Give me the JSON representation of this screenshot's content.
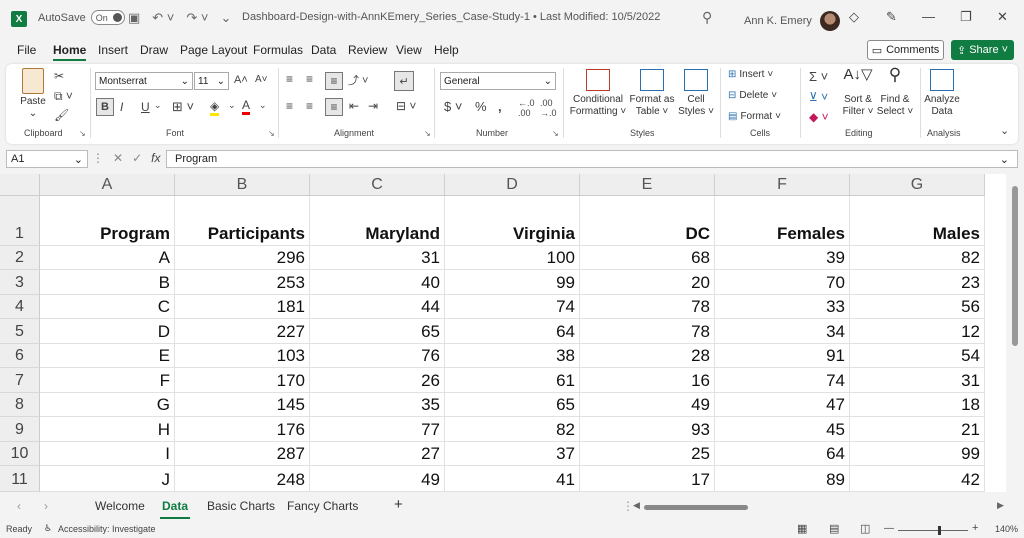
{
  "titlebar": {
    "app_icon": "X",
    "autosave_label": "AutoSave",
    "autosave_state": "On",
    "doc_title": "Dashboard-Design-with-AnnKEmery_Series_Case-Study-1 • Last Modified: 10/5/2022",
    "user_name": "Ann K. Emery"
  },
  "menu": {
    "tabs": [
      "File",
      "Home",
      "Insert",
      "Draw",
      "Page Layout",
      "Formulas",
      "Data",
      "Review",
      "View",
      "Help"
    ],
    "active": "Home",
    "comments": "Comments",
    "share": "Share"
  },
  "ribbon": {
    "clipboard": {
      "paste": "Paste",
      "label": "Clipboard"
    },
    "font": {
      "name": "Montserrat",
      "size": "11",
      "bold": "B",
      "italic": "I",
      "underline": "U",
      "label": "Font"
    },
    "alignment": {
      "label": "Alignment"
    },
    "number": {
      "format": "General",
      "label": "Number"
    },
    "styles": {
      "cond_l1": "Conditional",
      "cond_l2": "Formatting",
      "table_l1": "Format as",
      "table_l2": "Table",
      "cell_l1": "Cell",
      "cell_l2": "Styles",
      "label": "Styles"
    },
    "cells": {
      "insert": "Insert",
      "delete": "Delete",
      "format": "Format",
      "label": "Cells"
    },
    "editing": {
      "sort_l1": "Sort &",
      "sort_l2": "Filter",
      "find_l1": "Find &",
      "find_l2": "Select",
      "label": "Editing"
    },
    "analysis": {
      "l1": "Analyze",
      "l2": "Data",
      "label": "Analysis"
    }
  },
  "formula_bar": {
    "name_box": "A1",
    "content": "Program"
  },
  "grid": {
    "columns": [
      "A",
      "B",
      "C",
      "D",
      "E",
      "F",
      "G"
    ],
    "row_numbers": [
      "1",
      "2",
      "3",
      "4",
      "5",
      "6",
      "7",
      "8",
      "9",
      "10",
      "11"
    ],
    "header": [
      "Program",
      "Participants",
      "Maryland",
      "Virginia",
      "DC",
      "Females",
      "Males"
    ],
    "rows": [
      [
        "A",
        "296",
        "31",
        "100",
        "68",
        "39",
        "82"
      ],
      [
        "B",
        "253",
        "40",
        "99",
        "20",
        "70",
        "23"
      ],
      [
        "C",
        "181",
        "44",
        "74",
        "78",
        "33",
        "56"
      ],
      [
        "D",
        "227",
        "65",
        "64",
        "78",
        "34",
        "12"
      ],
      [
        "E",
        "103",
        "76",
        "38",
        "28",
        "91",
        "54"
      ],
      [
        "F",
        "170",
        "26",
        "61",
        "16",
        "74",
        "31"
      ],
      [
        "G",
        "145",
        "35",
        "65",
        "49",
        "47",
        "18"
      ],
      [
        "H",
        "176",
        "77",
        "82",
        "93",
        "45",
        "21"
      ],
      [
        "I",
        "287",
        "27",
        "37",
        "25",
        "64",
        "99"
      ],
      [
        "J",
        "248",
        "49",
        "41",
        "17",
        "89",
        "42"
      ]
    ]
  },
  "sheets": {
    "tabs": [
      "Welcome",
      "Data",
      "Basic Charts",
      "Fancy Charts"
    ],
    "active": "Data"
  },
  "status": {
    "ready": "Ready",
    "accessibility": "Accessibility: Investigate",
    "zoom": "140%"
  }
}
